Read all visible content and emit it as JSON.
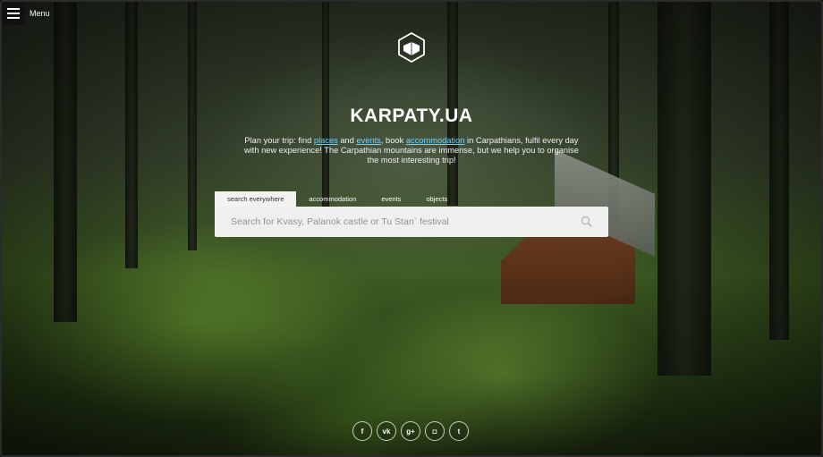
{
  "menu": {
    "label": "Menu"
  },
  "title": "KARPATY.UA",
  "description": {
    "part1": "Plan your trip: find ",
    "link_places": "places",
    "part2": " and ",
    "link_events": "events",
    "part3": ", book ",
    "link_accommodation": "accommodation",
    "part4": " in Carpathians, fulfil every day with new experience! The Carpathian mountains are immense, but we help you to organise the most interesting trip!"
  },
  "tabs": [
    {
      "label": "search everywhere",
      "active": true
    },
    {
      "label": "accommodation",
      "active": false
    },
    {
      "label": "events",
      "active": false
    },
    {
      "label": "objects",
      "active": false
    }
  ],
  "search": {
    "placeholder": "Search for Kvasy, Palanok castle or Tu Stan` festival"
  },
  "socials": [
    {
      "icon": "facebook-icon",
      "glyph": "f"
    },
    {
      "icon": "vk-icon",
      "glyph": "vk"
    },
    {
      "icon": "google-plus-icon",
      "glyph": "g+"
    },
    {
      "icon": "instagram-icon",
      "glyph": "◘"
    },
    {
      "icon": "twitter-icon",
      "glyph": "t"
    }
  ],
  "colors": {
    "link": "#6fd0ff",
    "search_bg": "#eef0ee"
  }
}
